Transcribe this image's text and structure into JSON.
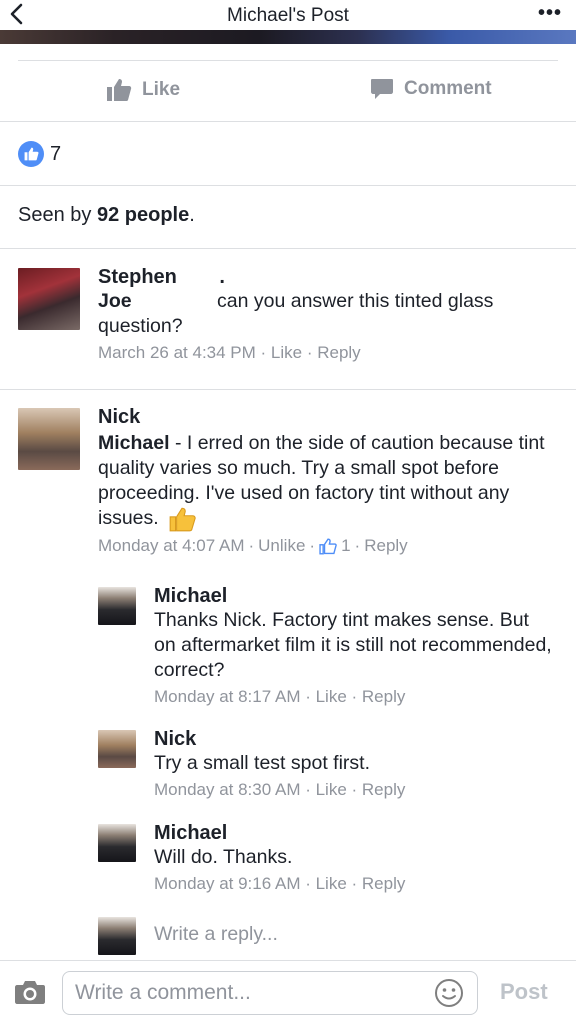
{
  "header": {
    "title": "Michael's Post",
    "back_icon": "chevron-left-icon",
    "more_label": "•••"
  },
  "actions": {
    "like_label": "Like",
    "comment_label": "Comment"
  },
  "likes": {
    "count": "7"
  },
  "seen": {
    "prefix": "Seen by ",
    "count": "92 people",
    "suffix": "."
  },
  "comments": [
    {
      "name": "Stephen",
      "name_suffix": ".",
      "mention": "Joe",
      "text": "can you answer this tinted glass question?",
      "time": "March 26 at 4:34 PM",
      "like_label": "Like",
      "reply_label": "Reply"
    },
    {
      "name": "Nick",
      "mention": "Michael",
      "text": " - I erred on the side of caution because tint quality varies so much. Try a small spot before proceeding. I've used on factory tint without any issues.",
      "time": "Monday at 4:07 AM",
      "like_label": "Unlike",
      "like_count": "1",
      "reply_label": "Reply",
      "replies": [
        {
          "name": "Michael",
          "text": "Thanks Nick.   Factory tint makes sense. But on aftermarket film it is still not recommended, correct?",
          "time": "Monday at 8:17 AM",
          "like_label": "Like",
          "reply_label": "Reply"
        },
        {
          "name": "Nick",
          "text": "Try a small test spot first.",
          "time": "Monday at 8:30 AM",
          "like_label": "Like",
          "reply_label": "Reply"
        },
        {
          "name": "Michael",
          "text": "Will do. Thanks.",
          "time": "Monday at 9:16 AM",
          "like_label": "Like",
          "reply_label": "Reply"
        }
      ],
      "reply_placeholder": "Write a reply..."
    }
  ],
  "composer": {
    "placeholder": "Write a comment...",
    "post_label": "Post"
  },
  "colors": {
    "accent": "#4f8ef7",
    "meta": "#90949c",
    "text": "#1d2129",
    "divider": "#dddfe2"
  }
}
